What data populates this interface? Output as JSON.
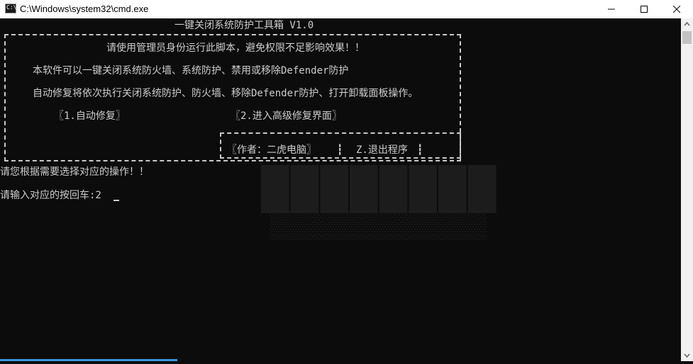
{
  "window": {
    "title": "C:\\Windows\\system32\\cmd.exe",
    "icon_text": "C:\\"
  },
  "console": {
    "header": "一键关闭系统防护工具箱 V1.0",
    "admin_notice": "请使用管理员身份运行此脚本，避免权限不足影响效果！！",
    "desc_line1": "本软件可以一键关闭系统防火墙、系统防护、禁用或移除Defender防护",
    "desc_line2": "自动修复将依次执行关闭系统防护、防火墙、移除Defender防护、打开卸载面板操作。",
    "option1": "〖1.自动修复〗",
    "option2": "〖2.进入高级修复界面〗",
    "author": "〖作者：二虎电脑〗",
    "sep": "┇",
    "exit_option": "Z.退出程序",
    "prompt1": "请您根据需要选择对应的操作！！",
    "prompt2": "请输入对应的按回车:2"
  }
}
